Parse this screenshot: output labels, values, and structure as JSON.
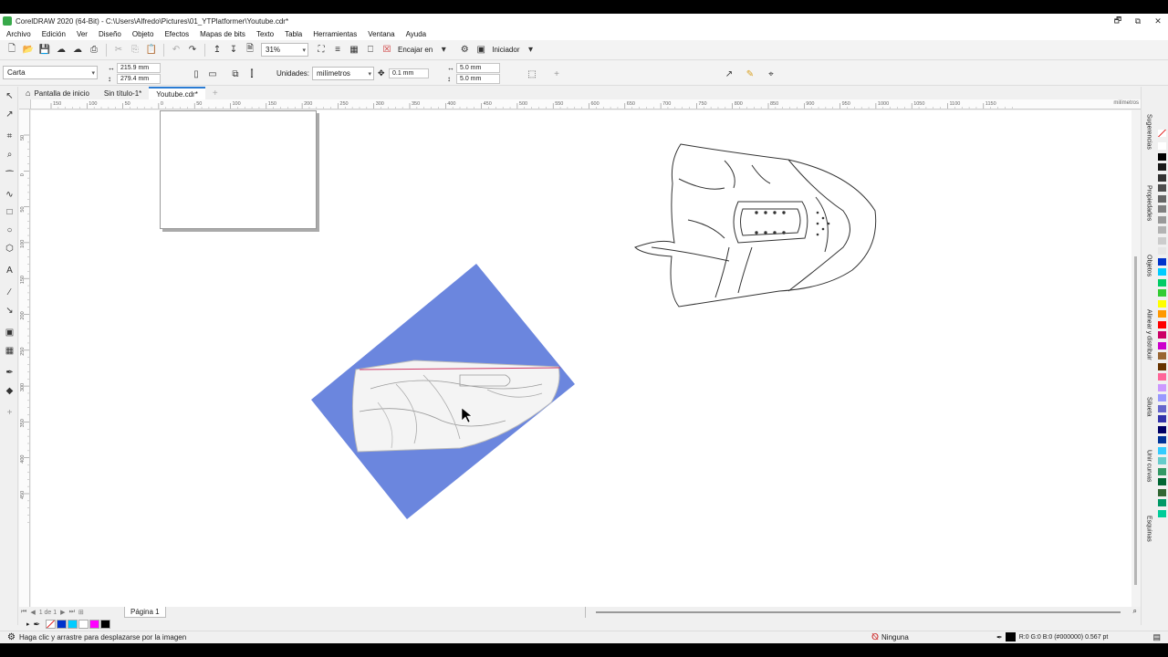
{
  "window": {
    "title": "CorelDRAW 2020 (64-Bit) - C:\\Users\\Alfredo\\Pictures\\01_YTPlatformer\\Youtube.cdr*",
    "controls": [
      "🗗",
      "⧉",
      "✕"
    ]
  },
  "menu": [
    "Archivo",
    "Edición",
    "Ver",
    "Diseño",
    "Objeto",
    "Efectos",
    "Mapas de bits",
    "Texto",
    "Tabla",
    "Herramientas",
    "Ventana",
    "Ayuda"
  ],
  "toolbar": {
    "zoom_value": "31%",
    "snap_label": "Encajar en",
    "launcher_label": "Iniciador"
  },
  "propbar": {
    "page_size": "Carta",
    "width": "215.9 mm",
    "height": "279.4 mm",
    "units_label": "Unidades:",
    "units_value": "milímetros",
    "nudge": "0.1 mm",
    "dup_x": "5.0 mm",
    "dup_y": "5.0 mm"
  },
  "tabs": [
    {
      "label": "Pantalla de inicio",
      "active": false
    },
    {
      "label": "Sin título-1*",
      "active": false
    },
    {
      "label": "Youtube.cdr*",
      "active": true
    }
  ],
  "ruler": {
    "h_labels": [
      "150",
      "100",
      "50",
      "0",
      "50",
      "100",
      "150",
      "200",
      "250",
      "300",
      "350",
      "400",
      "450",
      "500",
      "550",
      "600",
      "650",
      "700",
      "750",
      "800",
      "850",
      "900",
      "950",
      "1000",
      "1050",
      "1100",
      "1150"
    ],
    "units": "milímetros",
    "v_labels": [
      "50",
      "0",
      "50",
      "100",
      "150",
      "200",
      "250",
      "300",
      "350",
      "400",
      "450"
    ]
  },
  "dockers": [
    "Sugerencias",
    "Propiedades",
    "Objetos",
    "Alinear y distribuir",
    "Silueta",
    "Unir curvas",
    "Esquinas"
  ],
  "pagebar": {
    "page_of": "1 de 1",
    "page_label": "Página 1"
  },
  "status": {
    "hint": "Haga clic y arrastre para desplazarse por la imagen",
    "fill_label": "Ninguna",
    "outline_label": "R:0 G:0 B:0 (#000000) 0.567 pt"
  },
  "colors": {
    "accent": "#2b7cd3",
    "blue_shape": "#6b86de",
    "palette": [
      "#ffffff",
      "#000000",
      "#1a1a1a",
      "#333333",
      "#4d4d4d",
      "#666666",
      "#808080",
      "#999999",
      "#b3b3b3",
      "#cccccc",
      "#e6e6e6",
      "#0033cc",
      "#00ccff",
      "#00cc66",
      "#33cc33",
      "#ffff00",
      "#ff9900",
      "#ff0000",
      "#cc0066",
      "#cc00cc",
      "#996633",
      "#663300",
      "#ff6699",
      "#cc99ff",
      "#9999ff",
      "#6666cc",
      "#3333aa",
      "#000066",
      "#003399",
      "#33ccff",
      "#66cccc",
      "#339966",
      "#006633",
      "#336633",
      "#009966",
      "#00cc99"
    ],
    "doc_palette": [
      "#0033cc",
      "#00ccff",
      "#ffffff",
      "#ff00ff",
      "#000000"
    ]
  }
}
